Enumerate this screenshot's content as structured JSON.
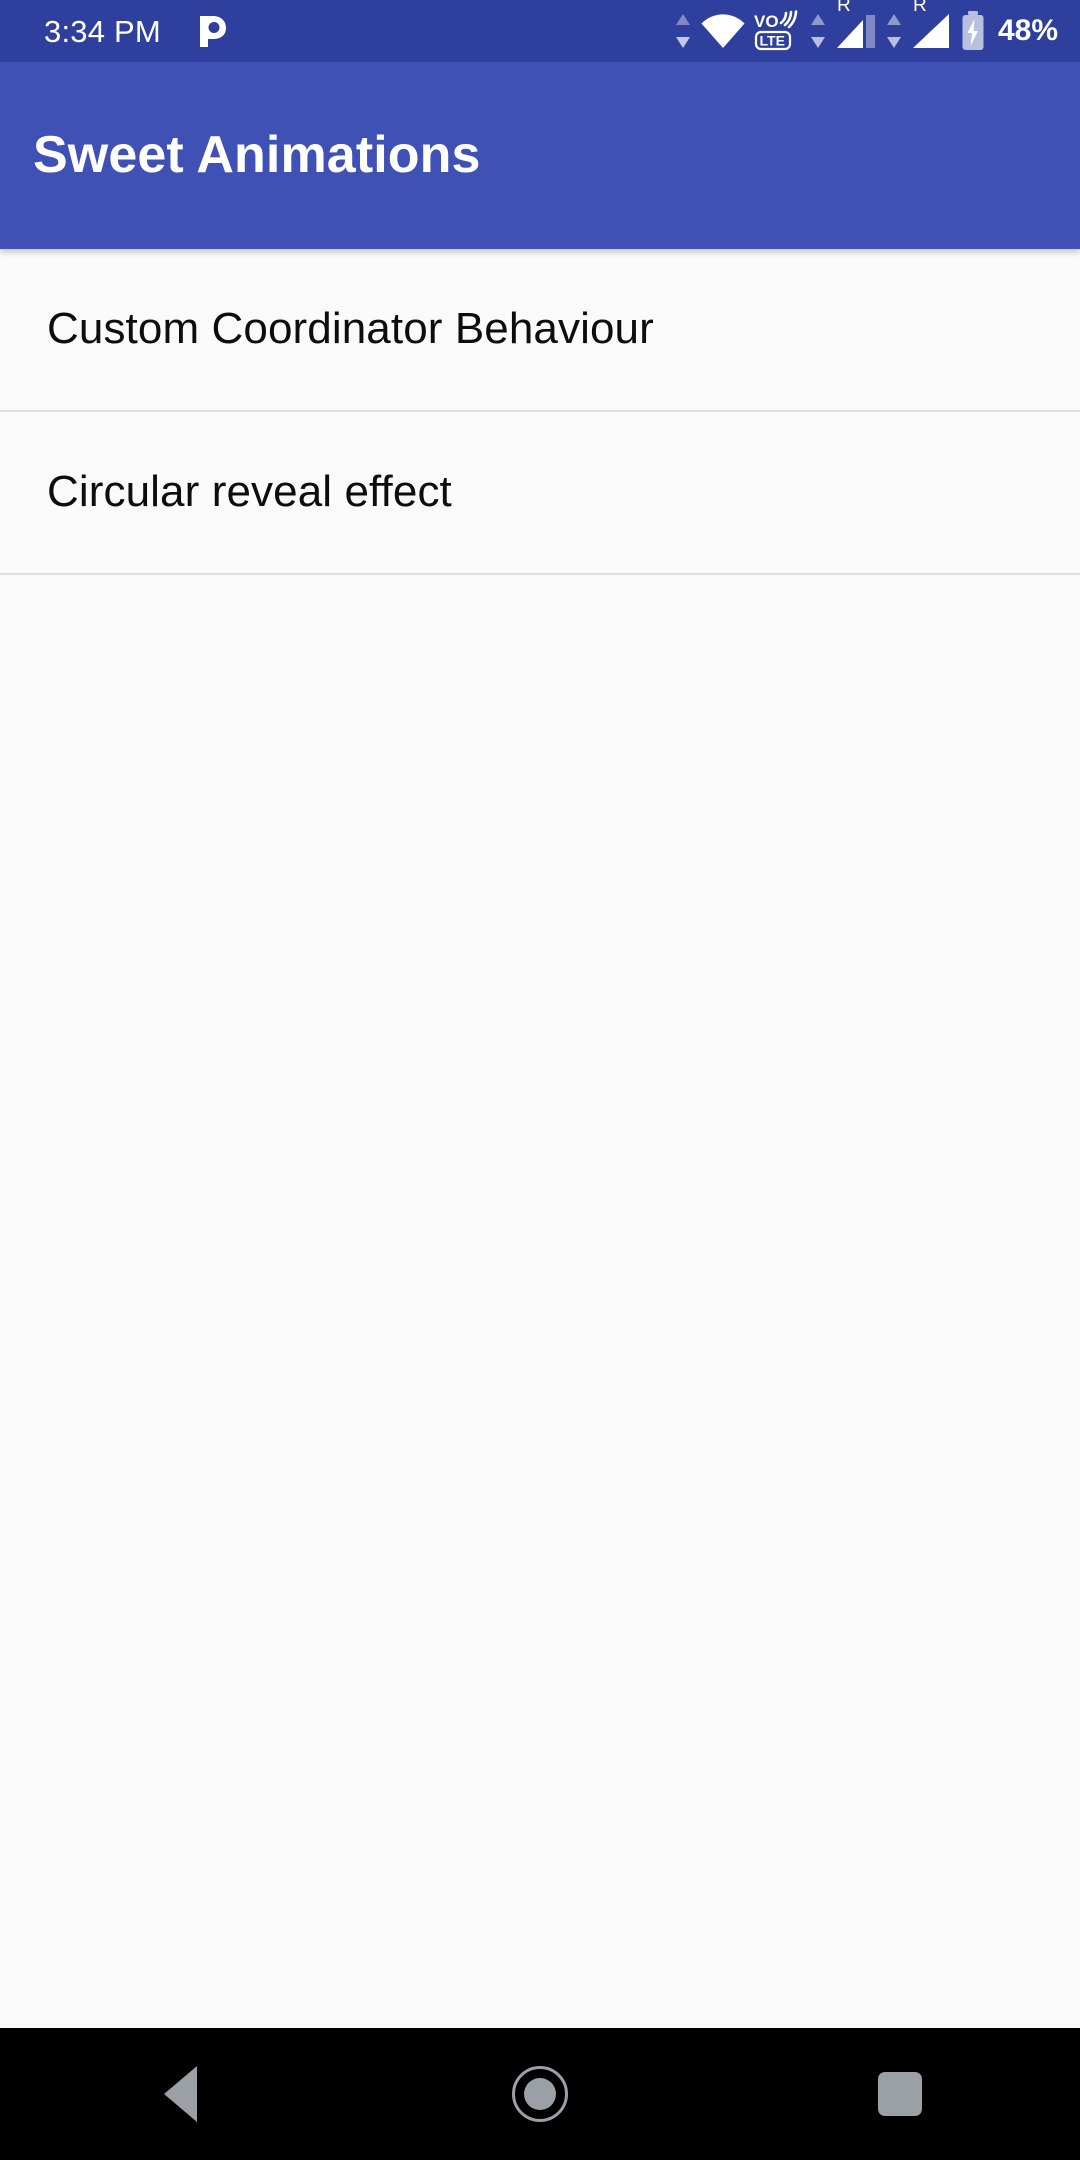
{
  "status_bar": {
    "clock": "3:34 PM",
    "battery_percent": "48%",
    "roaming_label_sim1": "R",
    "roaming_label_sim2": "R",
    "icons": [
      "pandora-notification-icon",
      "data-transfer-arrows-icon",
      "wifi-icon",
      "volte-icon",
      "data-transfer-arrows-icon",
      "cellular-signal-sim1-icon",
      "data-transfer-arrows-icon",
      "cellular-signal-sim2-icon",
      "battery-charging-icon"
    ],
    "volte_text_top": "VO",
    "volte_text_bottom": "LTE",
    "background_color": "#2f3f9e",
    "foreground_color": "#ffffff"
  },
  "app_bar": {
    "title": "Sweet Animations",
    "background_color": "#3f51b5",
    "title_color": "#ffffff"
  },
  "content": {
    "background_color": "#fafafa",
    "divider_color": "#e0e0e0",
    "items": [
      {
        "label": "Custom Coordinator Behaviour"
      },
      {
        "label": "Circular reveal effect"
      }
    ]
  },
  "nav_bar": {
    "background_color": "#000000",
    "icon_color": "#9aa0a6",
    "buttons": [
      {
        "name": "back",
        "icon": "triangle-back-icon"
      },
      {
        "name": "home",
        "icon": "circle-home-icon"
      },
      {
        "name": "recents",
        "icon": "square-recents-icon"
      }
    ]
  }
}
